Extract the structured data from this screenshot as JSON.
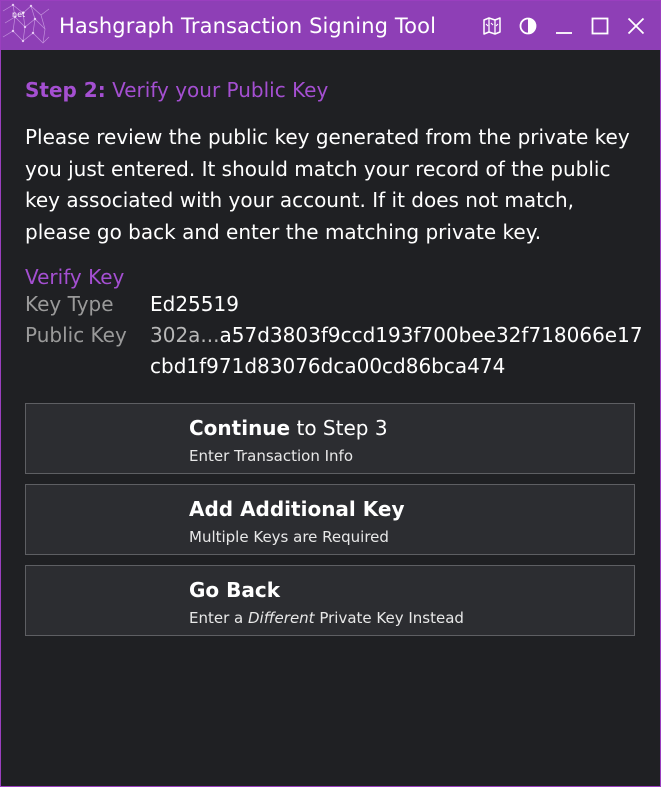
{
  "window": {
    "title": "Hashgraph Transaction Signing Tool",
    "logo_text": "net",
    "controls": [
      "map-icon",
      "contrast-icon",
      "minimize-icon",
      "maximize-icon",
      "close-icon"
    ]
  },
  "colors": {
    "titlebar": "#8e3fb6",
    "accent": "#a44fd1",
    "background": "#1f2023",
    "button_bg": "#2c2d31",
    "button_border": "#5e5f63"
  },
  "step": {
    "number_label": "Step 2:",
    "title": "Verify your Public Key"
  },
  "description": "Please review the public key generated from the private key you just entered. It should match your record of the public key associated with your account. If it does not match, please go back and enter the matching private key.",
  "verify": {
    "title": "Verify Key",
    "key_type_label": "Key Type",
    "key_type_value": "Ed25519",
    "public_key_label": "Public Key",
    "public_key_prefix": "302a...",
    "public_key_value": "a57d3803f9ccd193f700bee32f718066e17cbd1f971d83076dca00cd86bca474"
  },
  "buttons": {
    "continue": {
      "bold": "Continue",
      "rest": " to Step 3",
      "sub": "Enter Transaction Info"
    },
    "add_key": {
      "bold": "Add Additional Key",
      "sub": "Multiple Keys are Required"
    },
    "go_back": {
      "bold": "Go Back",
      "sub_pre": "Enter a ",
      "sub_em": "Different",
      "sub_post": " Private Key Instead"
    }
  }
}
